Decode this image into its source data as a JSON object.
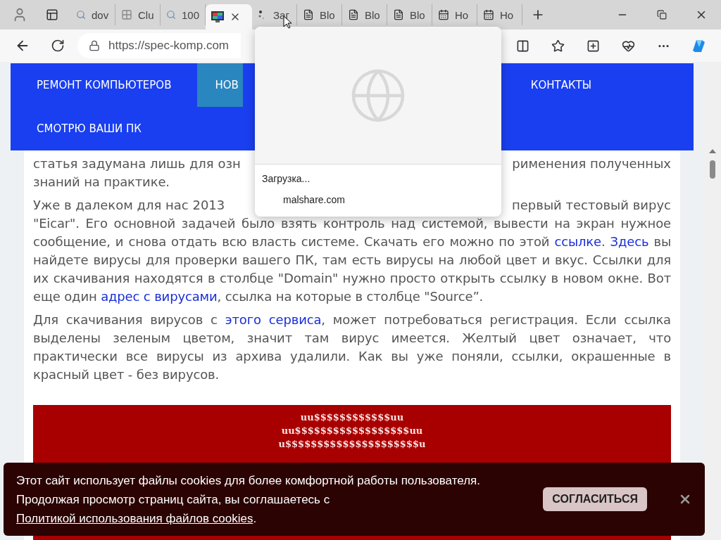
{
  "browser": {
    "tabs": [
      {
        "label": "dov",
        "kind": "search",
        "selected": false
      },
      {
        "label": "Clu",
        "kind": "grid",
        "selected": false
      },
      {
        "label": "100",
        "kind": "search",
        "selected": false
      },
      {
        "kind": "picture",
        "selected": true
      },
      {
        "label": "Заг",
        "kind": "loading",
        "selected": false
      },
      {
        "label": "Blo",
        "kind": "page",
        "selected": false
      },
      {
        "label": "Blo",
        "kind": "page",
        "selected": false
      },
      {
        "label": "Blo",
        "kind": "page",
        "selected": false
      },
      {
        "label": "Ho",
        "kind": "calendar",
        "selected": false
      },
      {
        "label": "Ho",
        "kind": "calendar",
        "selected": false
      }
    ],
    "address": "https://spec-komp.com"
  },
  "hover_card": {
    "status": "Загрузка...",
    "domain": "malshare.com"
  },
  "nav": {
    "rows": [
      [
        {
          "label": "РЕМОНТ КОМПЬЮТЕРОВ",
          "selected": false
        },
        {
          "label": "НОВ",
          "selected": true
        },
        {
          "label": "КОНТАКТЫ",
          "selected": false
        }
      ],
      [
        {
          "label": "СМОТРЮ ВАШИ ПК",
          "selected": false
        }
      ]
    ]
  },
  "article": {
    "paragraphs": [
      {
        "split_lines": [
          [
            "статья задумана лишь для озн",
            "рименения полученных"
          ]
        ],
        "segments": [
          {
            "kind": "text",
            "text": "знаний на практике."
          }
        ]
      },
      {
        "split_lines": [
          [
            "Уже в далеком для нас 2013",
            "первый тестовый вирус"
          ]
        ],
        "segments": [
          {
            "kind": "text",
            "text": "\"Eicar\". Его основной задачей было взять контроль над системой, вывести на экран нужное сообщение, и снова отдать всю власть системе. Скачать его можно по этой "
          },
          {
            "kind": "link",
            "text": "ссылке"
          },
          {
            "kind": "text",
            "text": ". "
          },
          {
            "kind": "link",
            "text": "Здесь"
          },
          {
            "kind": "text",
            "text": " вы найдете вирусы для проверки вашего ПК, там есть вирусы на любой цвет и вкус. Ссылки для их скачивания находятся в столбце \"Domain\" нужно просто открыть ссылку в новом окне. Вот еще один "
          },
          {
            "kind": "link",
            "text": "адрес с вирусами"
          },
          {
            "kind": "text",
            "text": ", ссылка на которые в столбце \"Source”."
          }
        ]
      },
      {
        "segments": [
          {
            "kind": "text",
            "text": "Для скачивания вирусов с "
          },
          {
            "kind": "link",
            "text": "этого сервиса"
          },
          {
            "kind": "text",
            "text": ", может потребоваться регистрация. Если ссылка выделены зеленым цветом, значит там вирус имеется. Желтый цвет означает, что практически все вирусы из архива удалили. Как вы уже поняли, ссылки, окрашенные в красный цвет - без вирусов."
          }
        ]
      }
    ]
  },
  "ascii_art": [
    "uu$$$$$$$$$$$$uu",
    "uu$$$$$$$$$$$$$$$$$$uu",
    "u$$$$$$$$$$$$$$$$$$$$$u"
  ],
  "cookie_banner": {
    "segments": [
      {
        "kind": "text",
        "text": "Этот сайт использует файлы cookies для более комфортной работы пользователя. Продолжая просмотр страниц сайта, вы соглашаетесь с "
      },
      {
        "kind": "link",
        "text": "Политикой использования файлов cookies"
      },
      {
        "kind": "text",
        "text": "."
      }
    ],
    "button": "СОГЛАСИТЬСЯ"
  }
}
